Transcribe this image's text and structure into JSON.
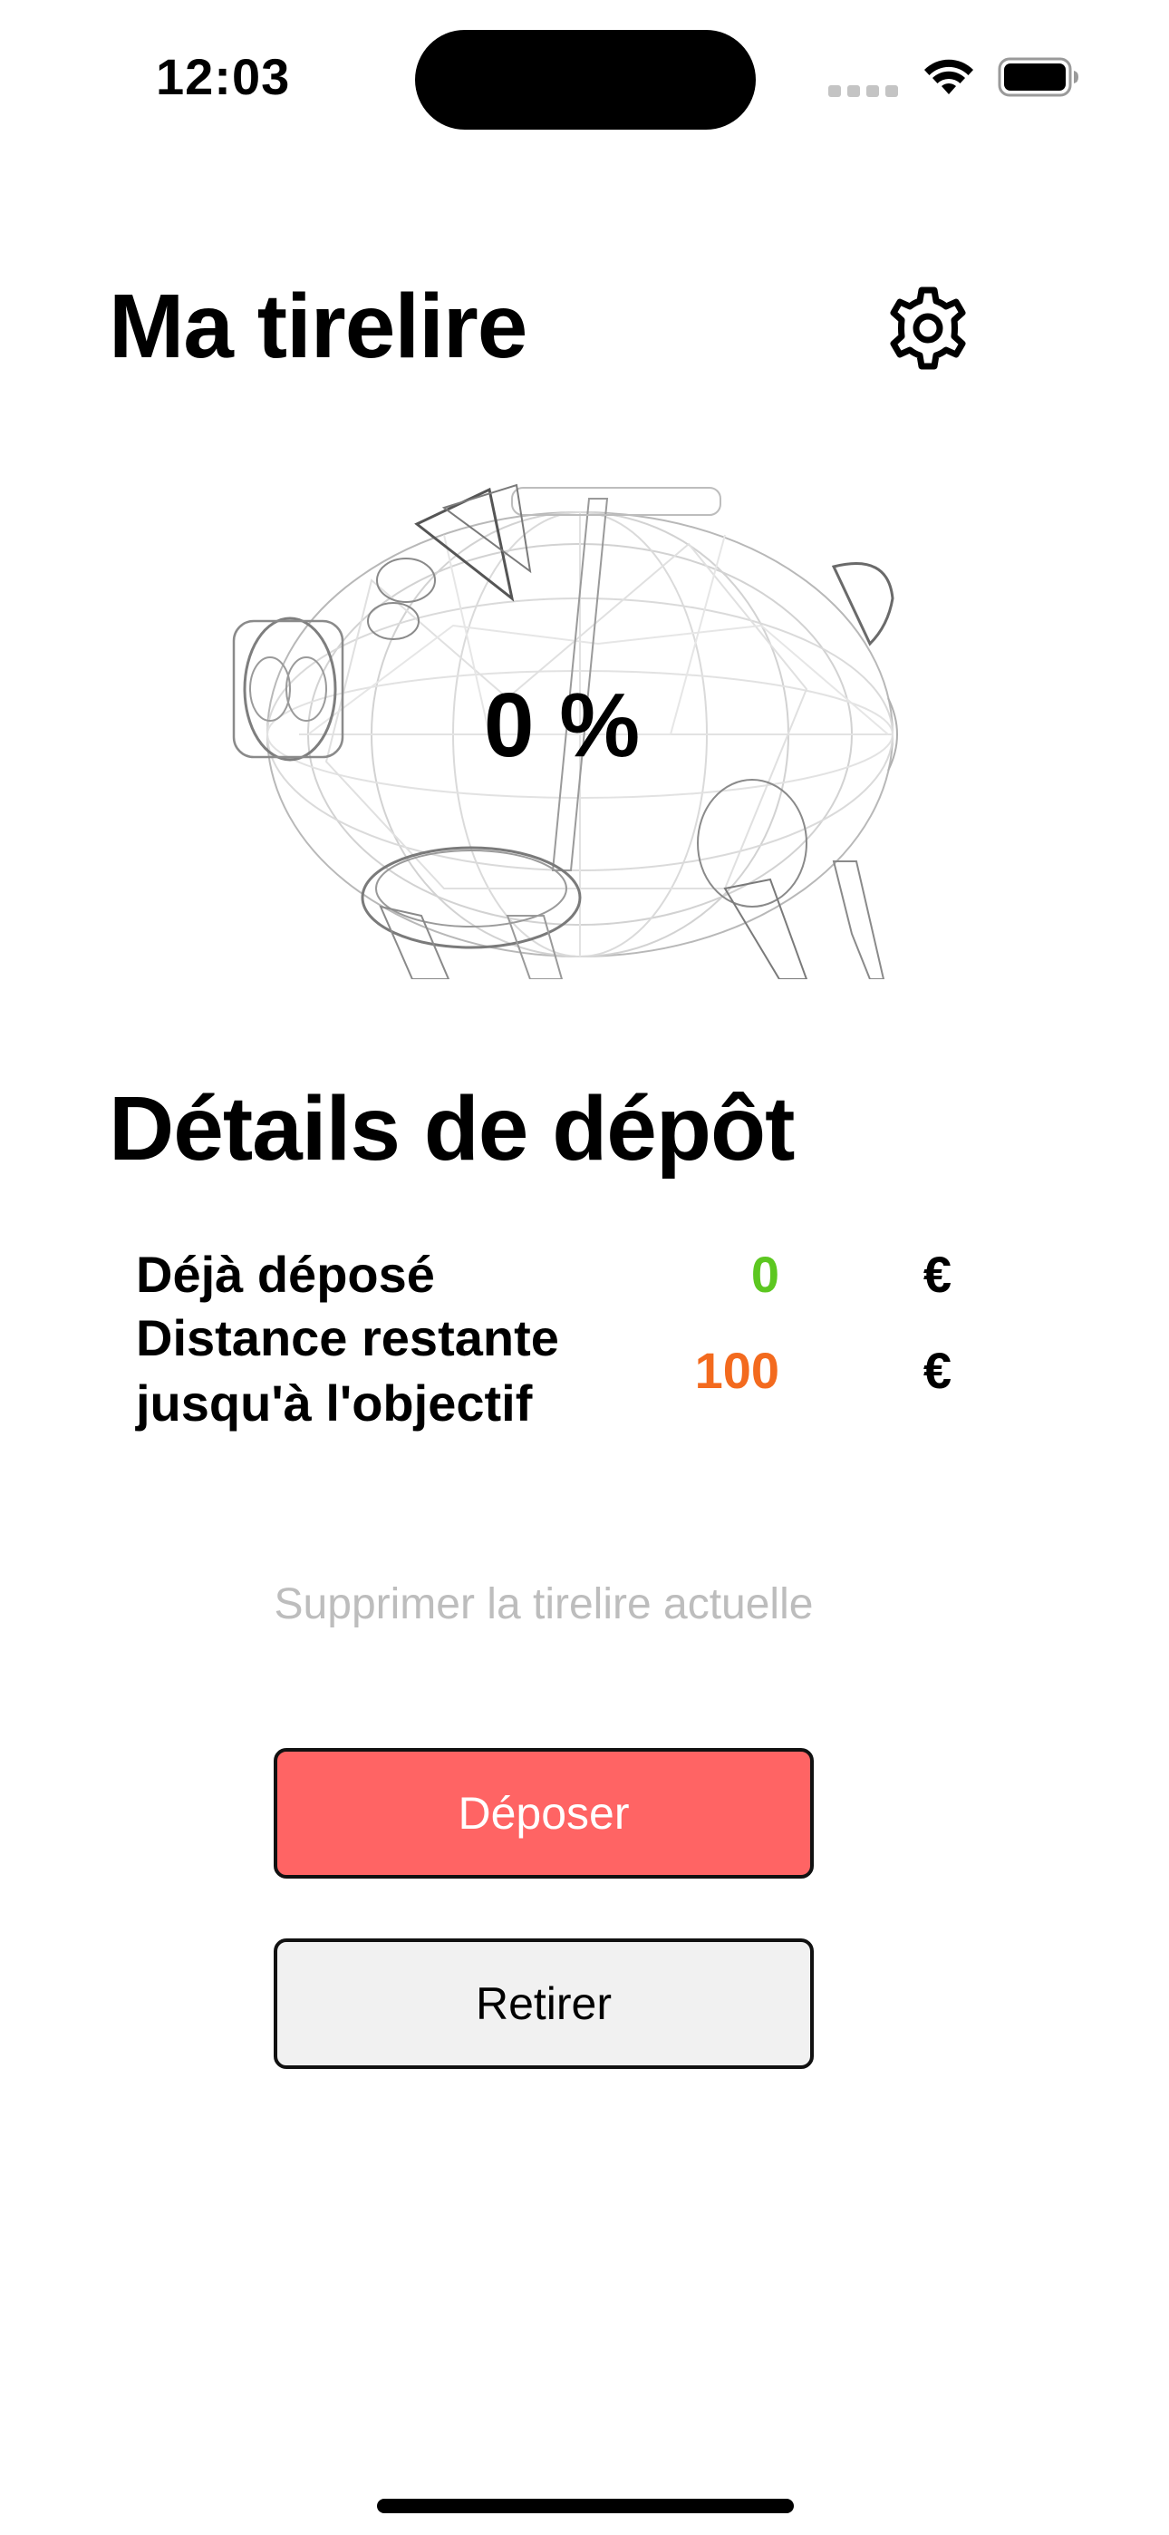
{
  "status_bar": {
    "time": "12:03"
  },
  "header": {
    "title": "Ma tirelire",
    "settings_icon": "gear-icon"
  },
  "piggy": {
    "progress_text": "0 %",
    "illustration": "piggy-bank-wireframe"
  },
  "details": {
    "title": "Détails de dépôt",
    "rows": [
      {
        "label": "Déjà déposé",
        "value": "0",
        "currency": "€",
        "color": "#5cc720"
      },
      {
        "label": "Distance restante jusqu'à l'objectif",
        "value": "100",
        "currency": "€",
        "color": "#f36a1e"
      }
    ]
  },
  "actions": {
    "delete_label": "Supprimer la tirelire actuelle",
    "deposit_label": "Déposer",
    "withdraw_label": "Retirer"
  },
  "colors": {
    "deposit_bg": "#ff6464",
    "deposit_text": "#ffffff",
    "withdraw_bg": "#f1f1f1",
    "withdraw_text": "#000000",
    "muted_text": "#bdbdbd"
  }
}
